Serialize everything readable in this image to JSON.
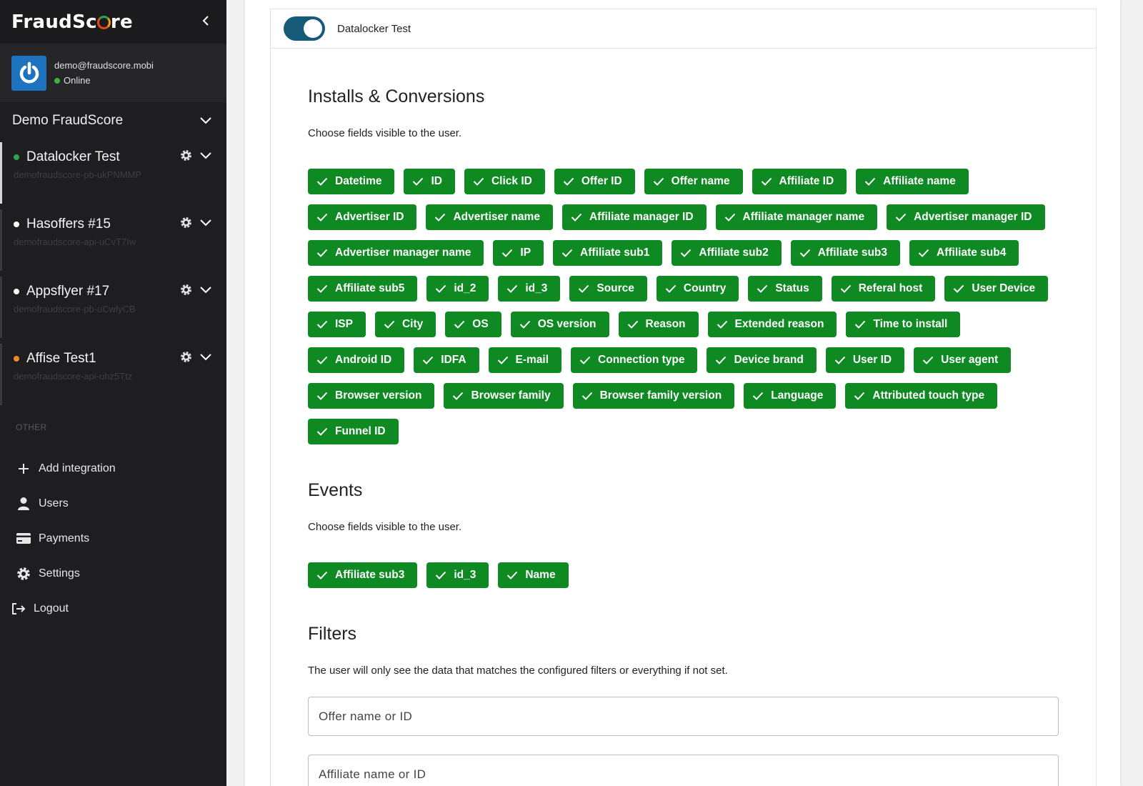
{
  "sidebar": {
    "brand": "FraudScore",
    "brand_pre": "FraudSc",
    "brand_post": "re",
    "user": {
      "email": "demo@fraudscore.mobi",
      "status": "Online",
      "status_color": "#3cb043"
    },
    "company": "Demo FraudScore",
    "integrations": [
      {
        "name": "Datalocker Test",
        "sub": "demofraudscore-pb-ukPNMMP",
        "dot": "#2ea44f",
        "active": true
      },
      {
        "name": "Hasoffers #15",
        "sub": "demofraudscore-api-uCvT7Iw",
        "dot": "#ffffff",
        "active": false
      },
      {
        "name": "Appsflyer #17",
        "sub": "demofraudscore-pb-uCwlyCB",
        "dot": "#ffffff",
        "active": false
      },
      {
        "name": "Affise Test1",
        "sub": "demofraudscore-api-uhz5Ttz",
        "dot": "#f08a24",
        "active": false
      }
    ],
    "other_label": "OTHER",
    "nav": [
      {
        "label": "Add integration",
        "icon": "plus-icon"
      },
      {
        "label": "Users",
        "icon": "user-icon"
      },
      {
        "label": "Payments",
        "icon": "credit-card-icon"
      },
      {
        "label": "Settings",
        "icon": "gear-icon"
      },
      {
        "label": "Logout",
        "icon": "logout-icon"
      }
    ]
  },
  "main": {
    "header_title": "Datalocker Test",
    "toggle_on": true,
    "installs": {
      "title": "Installs & Conversions",
      "desc": "Choose fields visible to the user.",
      "chips": [
        "Datetime",
        "ID",
        "Click ID",
        "Offer ID",
        "Offer name",
        "Affiliate ID",
        "Affiliate name",
        "Advertiser ID",
        "Advertiser name",
        "Affiliate manager ID",
        "Affiliate manager name",
        "Advertiser manager ID",
        "Advertiser manager name",
        "IP",
        "Affiliate sub1",
        "Affiliate sub2",
        "Affiliate sub3",
        "Affiliate sub4",
        "Affiliate sub5",
        "id_2",
        "id_3",
        "Source",
        "Country",
        "Status",
        "Referal host",
        "User Device",
        "ISP",
        "City",
        "OS",
        "OS version",
        "Reason",
        "Extended reason",
        "Time to install",
        "Android ID",
        "IDFA",
        "E-mail",
        "Connection type",
        "Device brand",
        "User ID",
        "User agent",
        "Browser version",
        "Browser family",
        "Browser family version",
        "Language",
        "Attributed touch type",
        "Funnel ID"
      ]
    },
    "events": {
      "title": "Events",
      "desc": "Choose fields visible to the user.",
      "chips": [
        "Affiliate sub3",
        "id_3",
        "Name"
      ]
    },
    "filters": {
      "title": "Filters",
      "desc": "The user will only see the data that matches the configured filters or everything if not set.",
      "fields": [
        {
          "placeholder": "Offer name or ID"
        },
        {
          "placeholder": "Affiliate name or ID"
        }
      ]
    },
    "colors": {
      "chip": "#0f8a23",
      "toggle": "#155b79",
      "sidebar": "#1e1e21"
    }
  }
}
